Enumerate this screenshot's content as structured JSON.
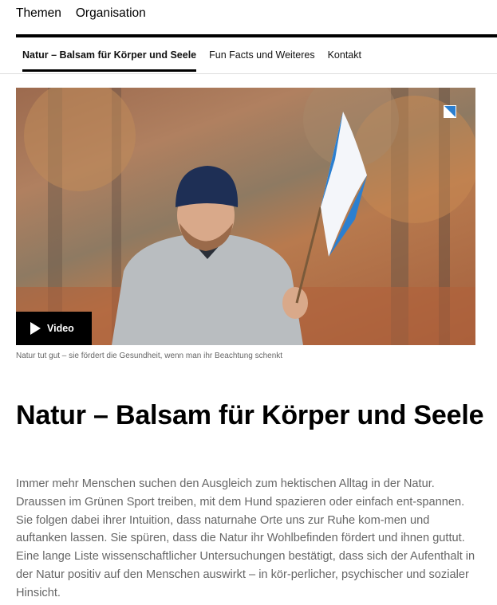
{
  "topnav": {
    "items": [
      "Themen",
      "Organisation"
    ]
  },
  "subnav": {
    "items": [
      "Natur – Balsam für Körper und Seele",
      "Fun Facts und Weiteres",
      "Kontakt"
    ]
  },
  "media": {
    "video_label": "Video",
    "caption": "Natur tut gut – sie fördert die Gesundheit, wenn man ihr Beachtung schenkt"
  },
  "article": {
    "title": "Natur – Balsam für Körper und Seele",
    "lead": "Immer mehr Menschen suchen den Ausgleich zum hektischen Alltag in der Natur. Draussen im Grünen Sport treiben, mit dem Hund spazieren oder einfach ent-spannen. Sie folgen dabei ihrer Intuition, dass naturnahe Orte uns zur Ruhe kom-men und auftanken lassen. Sie spüren, dass die Natur ihr Wohlbefinden fördert und ihnen guttut. Eine lange Liste wissenschaftlicher Untersuchungen bestätigt, dass sich der Aufenthalt in der Natur positiv auf den Menschen auswirkt – in kör-perlicher, psychischer und sozialer Hinsicht."
  },
  "colors": {
    "accent_blue": "#2b7fd0",
    "text_muted": "#666666"
  }
}
